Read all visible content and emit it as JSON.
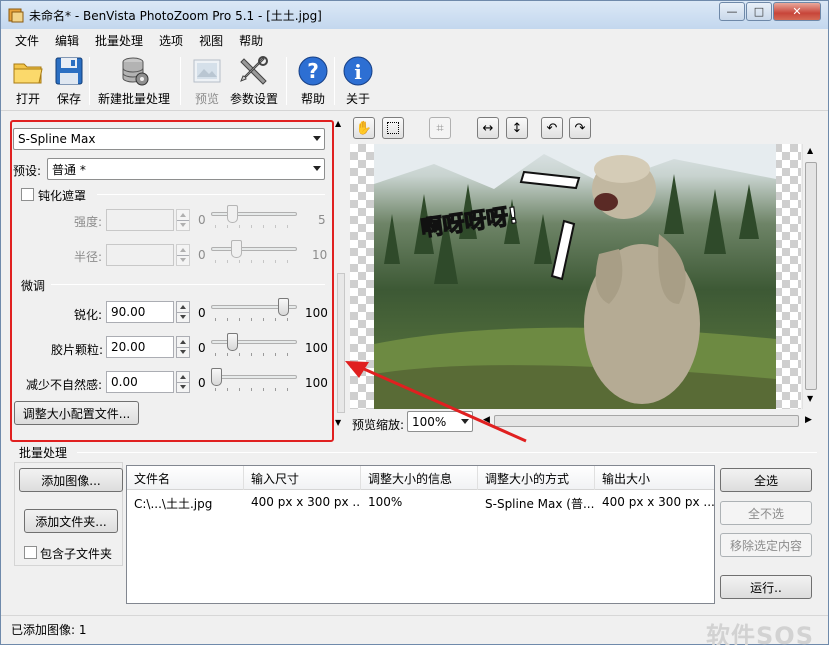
{
  "window": {
    "title": "未命名* - BenVista PhotoZoom Pro 5.1 - [土土.jpg]",
    "controls": [
      "—",
      "□",
      "✕"
    ]
  },
  "menu": [
    "文件",
    "编辑",
    "批量处理",
    "选项",
    "视图",
    "帮助"
  ],
  "toolbar": {
    "open": "打开",
    "save": "保存",
    "new_batch": "新建批量处理",
    "preview": "预览",
    "settings": "参数设置",
    "help": "帮助",
    "about": "关于"
  },
  "settings": {
    "method": "S-Spline Max",
    "preset_label": "预设:",
    "preset_value": "普通 *",
    "unsharp_mask": {
      "label": "钝化遮罩",
      "checked": false,
      "strength_label": "强度:",
      "strength_min": "0",
      "strength_max": "5",
      "radius_label": "半径:",
      "radius_min": "0",
      "radius_max": "10"
    },
    "fine_tune": {
      "label": "微调",
      "sharpen_label": "锐化:",
      "sharpen_value": "90.00",
      "sharpen_min": "0",
      "sharpen_max": "100",
      "grain_label": "胶片颗粒:",
      "grain_value": "20.00",
      "grain_min": "0",
      "grain_max": "100",
      "artifact_label": "减少不自然感:",
      "artifact_value": "0.00",
      "artifact_min": "0",
      "artifact_max": "100"
    },
    "profile_button": "调整大小配置文件..."
  },
  "preview": {
    "zoom_label": "预览缩放:",
    "zoom_value": "100%",
    "caption": "啊呀呀呀!"
  },
  "batch": {
    "title": "批量处理",
    "add_image": "添加图像...",
    "add_folder": "添加文件夹...",
    "include_subfolders": "包含子文件夹",
    "columns": [
      "文件名",
      "输入尺寸",
      "调整大小的信息",
      "调整大小的方式",
      "输出大小"
    ],
    "rows": [
      [
        "C:\\...\\土土.jpg",
        "400 px x 300 px ...",
        "100%",
        "S-Spline Max (普...",
        "400 px x 300 px ..."
      ]
    ],
    "select_all": "全选",
    "select_none": "全不选",
    "remove_selected": "移除选定内容",
    "run": "运行.."
  },
  "status": {
    "text": "已添加图像: 1",
    "watermark": "软件SOS"
  },
  "colors": {
    "highlight_frame": "#e02020",
    "arrow": "#e02020",
    "title_bar": "#c3d7ee"
  }
}
